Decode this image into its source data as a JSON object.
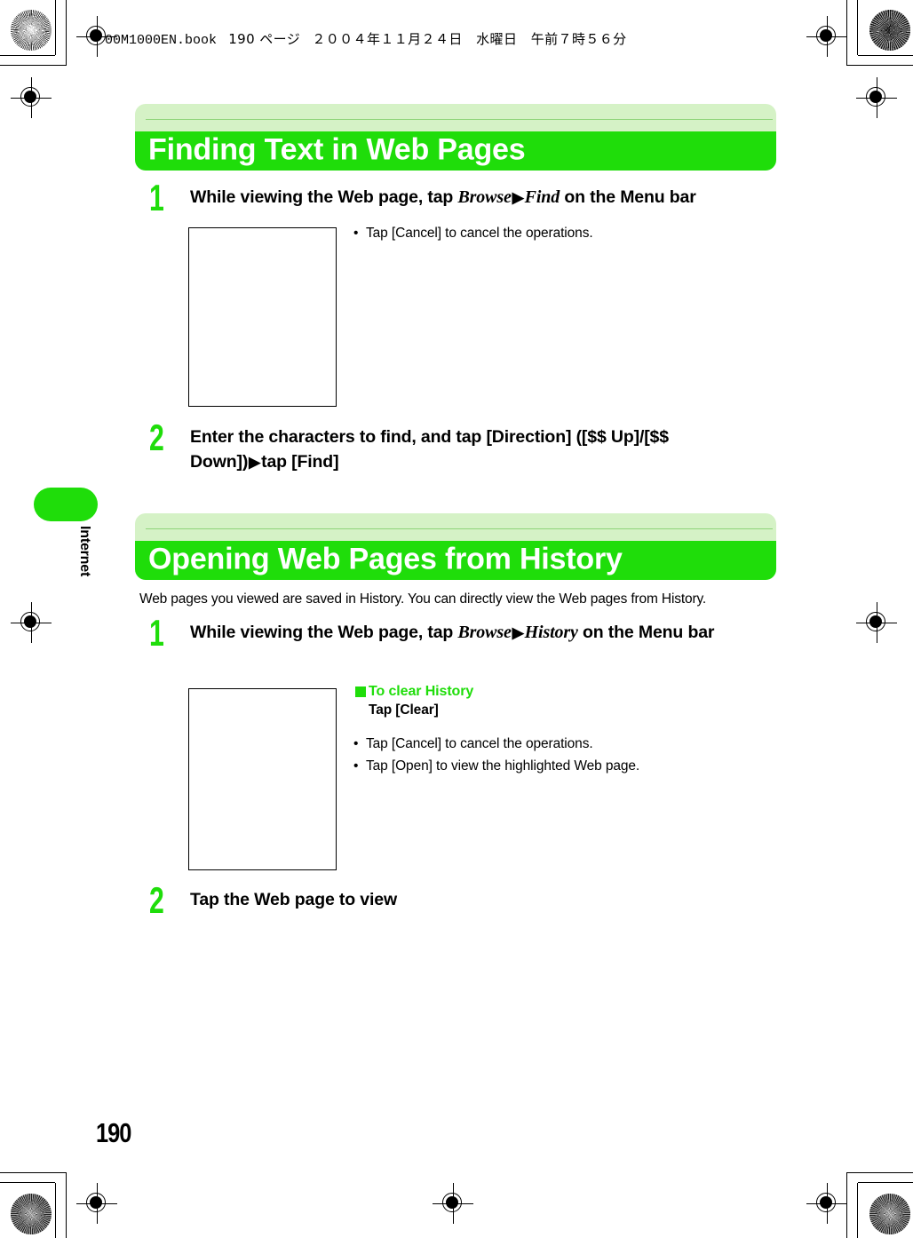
{
  "header": {
    "filename": "00M1000EN.book",
    "page_label": "190 ページ",
    "date": "２００４年１１月２４日　水曜日　午前７時５６分"
  },
  "side_tab": {
    "label": "Internet"
  },
  "page_number": "190",
  "colors": {
    "accent_green": "#1fdd0a",
    "banner_light_green": "#d5f2c6",
    "text_black": "#000000"
  },
  "sections": [
    {
      "title": "Finding Text in Web Pages",
      "lead": "",
      "steps": [
        {
          "number": "1",
          "text_parts": [
            {
              "style": "bold",
              "text": "While viewing the Web page, tap "
            },
            {
              "style": "italic",
              "text": "Browse"
            },
            {
              "style": "arrow",
              "text": " ▶ "
            },
            {
              "style": "italic",
              "text": "Find"
            },
            {
              "style": "bold",
              "text": " on the Menu bar"
            }
          ]
        },
        {
          "number": "2",
          "text_parts": [
            {
              "style": "bold",
              "text": "Enter the characters to find, and tap [Direction] ([$$ Up]/[$$ Down])"
            },
            {
              "style": "arrow",
              "text": " ▶ "
            },
            {
              "style": "bold",
              "text": "tap [Find]"
            }
          ]
        }
      ],
      "bullets": [
        "Tap [Cancel] to cancel the operations."
      ]
    },
    {
      "title": "Opening Web Pages from History",
      "lead": "Web pages you viewed are saved in History. You can directly view the Web pages from History.",
      "steps": [
        {
          "number": "1",
          "text_parts": [
            {
              "style": "bold",
              "text": "While viewing the Web page, tap "
            },
            {
              "style": "italic",
              "text": "Browse"
            },
            {
              "style": "arrow",
              "text": " ▶ "
            },
            {
              "style": "italic",
              "text": "History"
            },
            {
              "style": "bold",
              "text": " on the Menu bar"
            }
          ]
        },
        {
          "number": "2",
          "text_parts": [
            {
              "style": "bold",
              "text": "Tap the Web page to view"
            }
          ]
        }
      ],
      "subhead": {
        "title": "To clear History",
        "sub": "Tap [Clear]"
      },
      "bullets": [
        "Tap [Cancel] to cancel the operations.",
        "Tap [Open] to view the highlighted Web page."
      ]
    }
  ],
  "step_text_flat": {
    "s1_step1_a": "While viewing the Web page, tap ",
    "s1_step1_browse": "Browse",
    "s1_step1_find": "Find",
    "s1_step1_b": " on the Menu bar",
    "s1_step2_a": "Enter the characters to find, and tap [Direction] ([$$ Up]/[$$",
    "s1_step2_b": "Down])",
    "s1_step2_c": "tap [Find]",
    "s2_step1_a": "While viewing the Web page, tap ",
    "s2_step1_browse": "Browse",
    "s2_step1_history": "History",
    "s2_step1_b": " on the Menu",
    "s2_step1_c": "bar",
    "s2_step2_a": "Tap the Web page to view"
  },
  "arrow_glyph": "▶",
  "bullet_glyph": "•"
}
